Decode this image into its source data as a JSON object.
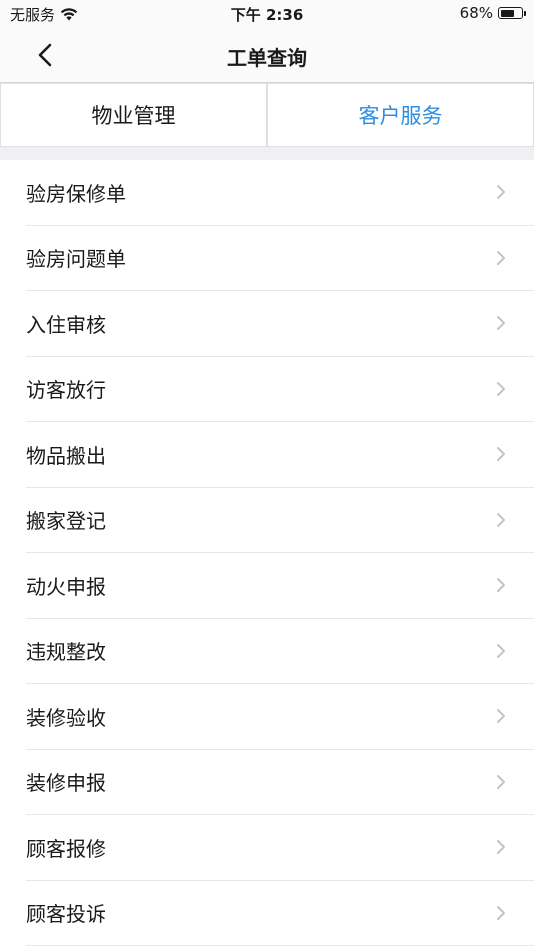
{
  "status_bar": {
    "carrier": "无服务",
    "time": "下午 2:36",
    "battery_percent": "68%",
    "battery_level": 0.68
  },
  "nav": {
    "title": "工单查询",
    "back_icon": "chevron-left-icon"
  },
  "tabs": [
    {
      "label": "物业管理",
      "active": false
    },
    {
      "label": "客户服务",
      "active": true
    }
  ],
  "colors": {
    "accent": "#2d8ce3",
    "separator": "#eef0f3",
    "chevron": "#c4c4c4"
  },
  "list": {
    "items": [
      {
        "label": "验房保修单"
      },
      {
        "label": "验房问题单"
      },
      {
        "label": "入住审核"
      },
      {
        "label": "访客放行"
      },
      {
        "label": "物品搬出"
      },
      {
        "label": "搬家登记"
      },
      {
        "label": "动火申报"
      },
      {
        "label": "违规整改"
      },
      {
        "label": "装修验收"
      },
      {
        "label": "装修申报"
      },
      {
        "label": "顾客报修"
      },
      {
        "label": "顾客投诉"
      }
    ]
  }
}
